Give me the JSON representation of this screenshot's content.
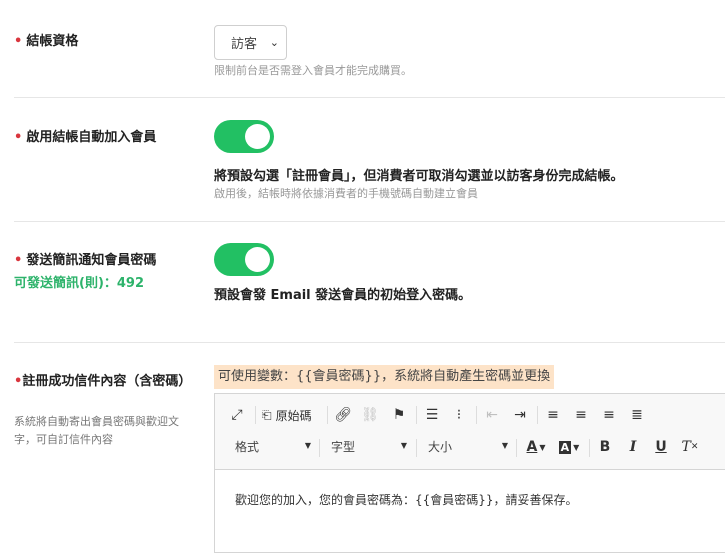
{
  "checkout_eligibility": {
    "label": "結帳資格",
    "select_value": "訪客",
    "help": "限制前台是否需登入會員才能完成購買。"
  },
  "auto_join": {
    "label": "啟用結帳自動加入會員",
    "enabled": true,
    "description": "將預設勾選「註冊會員」，但消費者可取消勾選並以訪客身份完成結帳。",
    "help": "啟用後，結帳時將依據消費者的手機號碼自動建立會員"
  },
  "sms_password": {
    "label": "發送簡訊通知會員密碼",
    "sms_quota": "可發送簡訊(則)：492",
    "enabled": true,
    "description": "預設會發 Email 發送會員的初始登入密碼。"
  },
  "signup_email": {
    "label": "註冊成功信件內容（含密碼）",
    "sublabel": "系統將自動寄出會員密碼與歡迎文字，可自訂信件內容",
    "hint": "可使用變數：{{會員密碼}}，系統將自動產生密碼並更換",
    "editor": {
      "source_label": "原始碼",
      "format_label": "格式",
      "font_label": "字型",
      "size_label": "大小",
      "content": "歡迎您的加入，您的會員密碼為：{{會員密碼}}，請妥善保存。"
    }
  },
  "colors": {
    "required": "#d9363e",
    "toggle_on": "#22c063",
    "quota": "#2db36b",
    "hint_bg": "#fde3c8"
  }
}
